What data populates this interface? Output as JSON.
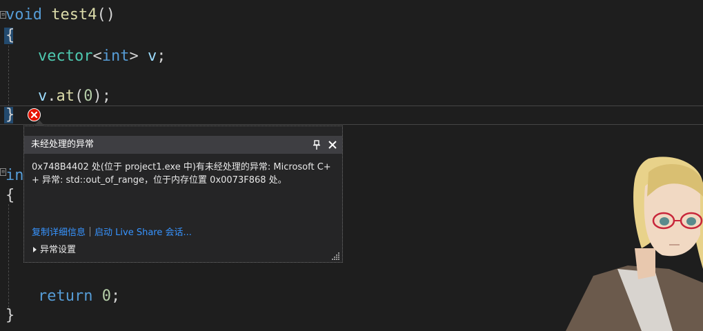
{
  "editor": {
    "lines": {
      "fn_keyword": "void",
      "fn_name": "test4",
      "fn_parens": "()",
      "open_brace": "{",
      "vec_type": "vector",
      "vec_lt": "<",
      "vec_int": "int",
      "vec_gt": ">",
      "vec_var": "v",
      "vec_semi": ";",
      "call_var": "v",
      "call_dot": ".",
      "call_fn": "at",
      "call_open": "(",
      "call_arg": "0",
      "call_close": ");",
      "close_brace": "}",
      "partial_keyword": "int",
      "open_brace2": "{",
      "ret_keyword": "return",
      "ret_value": "0",
      "ret_semi": ";",
      "close_brace2": "}"
    },
    "fold_marker": "⊟"
  },
  "exception_popup": {
    "title": "未经处理的异常",
    "message": "0x748B4402 处(位于 project1.exe 中)有未经处理的异常: Microsoft C++ 异常: std::out_of_range，位于内存位置 0x0073F868 处。",
    "link_copy_details": "复制详细信息",
    "link_live_share": "启动 Live Share 会话...",
    "exception_settings": "异常设置"
  },
  "colors": {
    "background": "#1e1e1e",
    "error": "#e51400",
    "link": "#3794ff",
    "keyword": "#569cd6",
    "type": "#4ec9b0"
  },
  "icons": [
    "error-icon",
    "pin-icon",
    "close-icon",
    "expand-triangle-icon",
    "resize-grip-icon",
    "fold-icon"
  ]
}
